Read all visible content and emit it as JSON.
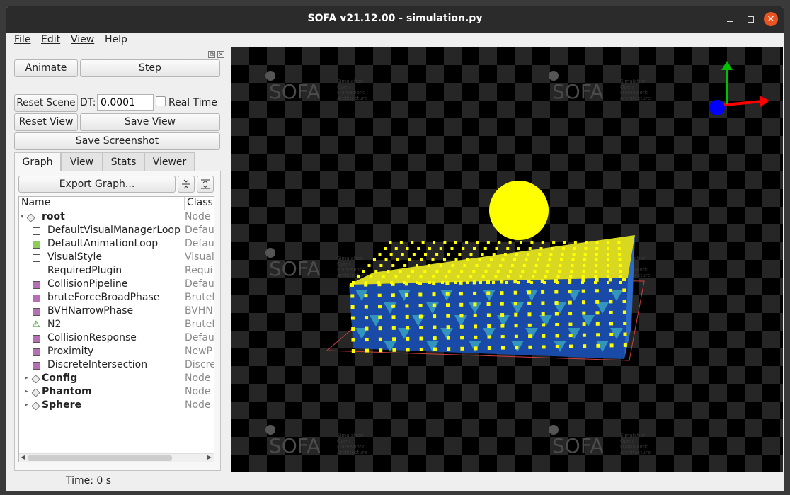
{
  "window": {
    "title": "SOFA v21.12.00 - simulation.py"
  },
  "menu": {
    "file": "File",
    "edit": "Edit",
    "view": "View",
    "help": "Help"
  },
  "controls": {
    "animate": "Animate",
    "step": "Step",
    "reset_scene": "Reset Scene",
    "dt_label": "DT:",
    "dt_value": "0.0001",
    "real_time": "Real Time",
    "real_time_checked": false,
    "reset_view": "Reset View",
    "save_view": "Save View",
    "save_screenshot": "Save Screenshot"
  },
  "tabs": [
    "Graph",
    "View",
    "Stats",
    "Viewer"
  ],
  "graph": {
    "export_button": "Export Graph...",
    "columns": {
      "name": "Name",
      "class": "Class"
    },
    "rows": [
      {
        "name": "root",
        "cls": "Node",
        "bold": true,
        "expanded": true,
        "icon": "node-icon"
      },
      {
        "name": "DefaultVisualManagerLoop",
        "cls": "Defau",
        "icon": "white-square-icon"
      },
      {
        "name": "DefaultAnimationLoop",
        "cls": "Defau",
        "icon": "green-square-icon"
      },
      {
        "name": "VisualStyle",
        "cls": "Visual",
        "icon": "white-square-icon"
      },
      {
        "name": "RequiredPlugin",
        "cls": "Requi",
        "icon": "white-square-icon"
      },
      {
        "name": "CollisionPipeline",
        "cls": "Defau",
        "icon": "purple-square-icon"
      },
      {
        "name": "bruteForceBroadPhase",
        "cls": "BruteI",
        "icon": "purple-square-icon"
      },
      {
        "name": "BVHNarrowPhase",
        "cls": "BVHN",
        "icon": "purple-square-icon"
      },
      {
        "name": "N2",
        "cls": "BruteI",
        "icon": "warning-icon"
      },
      {
        "name": "CollisionResponse",
        "cls": "Defau",
        "icon": "purple-square-icon"
      },
      {
        "name": "Proximity",
        "cls": "NewP",
        "icon": "purple-square-icon"
      },
      {
        "name": "DiscreteIntersection",
        "cls": "Discre",
        "icon": "purple-square-icon"
      },
      {
        "name": "Config",
        "cls": "Node",
        "bold": true,
        "expanded": false,
        "icon": "node-icon"
      },
      {
        "name": "Phantom",
        "cls": "Node",
        "bold": true,
        "expanded": false,
        "icon": "node-icon"
      },
      {
        "name": "Sphere",
        "cls": "Node",
        "bold": true,
        "expanded": false,
        "icon": "node-icon"
      }
    ]
  },
  "status": {
    "time": "Time: 0 s"
  },
  "viewer": {
    "logo_text": "SOFA",
    "logo_subtext": [
      "Simulation",
      "Open",
      "Framework",
      "Architecture"
    ],
    "colors": {
      "points": "#ffff00",
      "axis_x": "#ff0000",
      "axis_y": "#00c000",
      "axis_z": "#0000ff"
    }
  }
}
